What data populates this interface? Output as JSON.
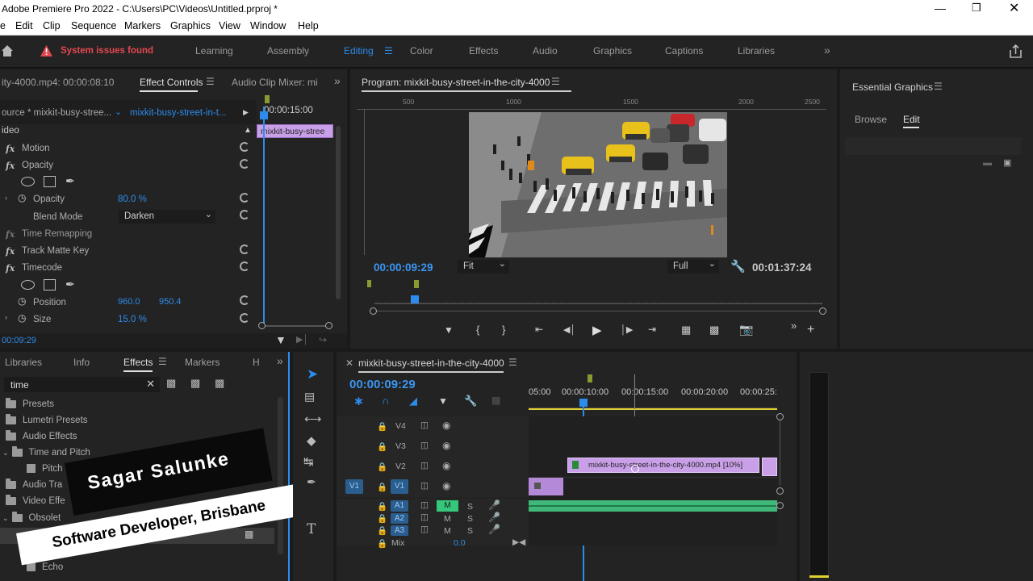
{
  "window": {
    "title": "Adobe Premiere Pro 2022 - C:\\Users\\PC\\Videos\\Untitled.prproj *"
  },
  "menu": [
    "e",
    "Edit",
    "Clip",
    "Sequence",
    "Markers",
    "Graphics",
    "View",
    "Window",
    "Help"
  ],
  "workspace": {
    "alert": "System issues found",
    "tabs": [
      "Learning",
      "Assembly",
      "Editing",
      "Color",
      "Effects",
      "Audio",
      "Graphics",
      "Captions",
      "Libraries"
    ],
    "active": "Editing"
  },
  "effect_controls": {
    "tab_source": "ity-4000.mp4: 00:00:08:10",
    "tab_active": "Effect Controls",
    "tab_audio": "Audio Clip Mixer: mi",
    "source_label": "ource * mixkit-busy-stree...",
    "clip_label": "mixkit-busy-street-in-t...",
    "timeline_time": "00:00:15:00",
    "clip_bar": "mixkit-busy-stree",
    "section": "ideo",
    "rows": {
      "motion": "Motion",
      "opacity_group": "Opacity",
      "opacity": "Opacity",
      "opacity_val": "80.0 %",
      "blend_mode": "Blend Mode",
      "blend_val": "Darken",
      "time_remap": "Time Remapping",
      "track_matte": "Track Matte Key",
      "timecode": "Timecode",
      "position": "Position",
      "pos_x": "960.0",
      "pos_y": "950.4",
      "size": "Size",
      "size_val": "15.0 %"
    },
    "footer_time": "00:09:29"
  },
  "program": {
    "title": "Program: mixkit-busy-street-in-the-city-4000",
    "ruler": [
      "500",
      "1000",
      "1500",
      "2000",
      "2500"
    ],
    "current_time": "00:00:09:29",
    "fit": "Fit",
    "quality": "Full",
    "duration": "00:01:37:24"
  },
  "essential_graphics": {
    "title": "Essential Graphics",
    "tabs": [
      "Browse",
      "Edit"
    ],
    "active": "Edit"
  },
  "effects_panel": {
    "tabs": [
      "Libraries",
      "Info",
      "Effects",
      "Markers",
      "H"
    ],
    "active": "Effects",
    "search": "time",
    "items": [
      "Presets",
      "Lumetri Presets",
      "Audio Effects",
      "Time and Pitch",
      "Pitch Shifter",
      "Audio Tra",
      "Video Effe",
      "Obsolet",
      "Echo"
    ]
  },
  "overlay": {
    "name": "Sagar Salunke",
    "role": "Software Developer, Brisbane"
  },
  "timeline": {
    "title": "mixkit-busy-street-in-the-city-4000",
    "time": "00:00:09:29",
    "ruler": [
      "05:00",
      "00:00:10:00",
      "00:00:15:00",
      "00:00:20:00",
      "00:00:25:"
    ],
    "video_tracks": [
      "V4",
      "V3",
      "V2",
      "V1"
    ],
    "src_v1": "V1",
    "audio_tracks": [
      "A1",
      "A2",
      "A3"
    ],
    "mix_label": "Mix",
    "mix_val": "0.0",
    "clip_v2": "mixkit-busy-street-in-the-city-4000.mp4 [10%]",
    "m": "M",
    "s": "S"
  }
}
